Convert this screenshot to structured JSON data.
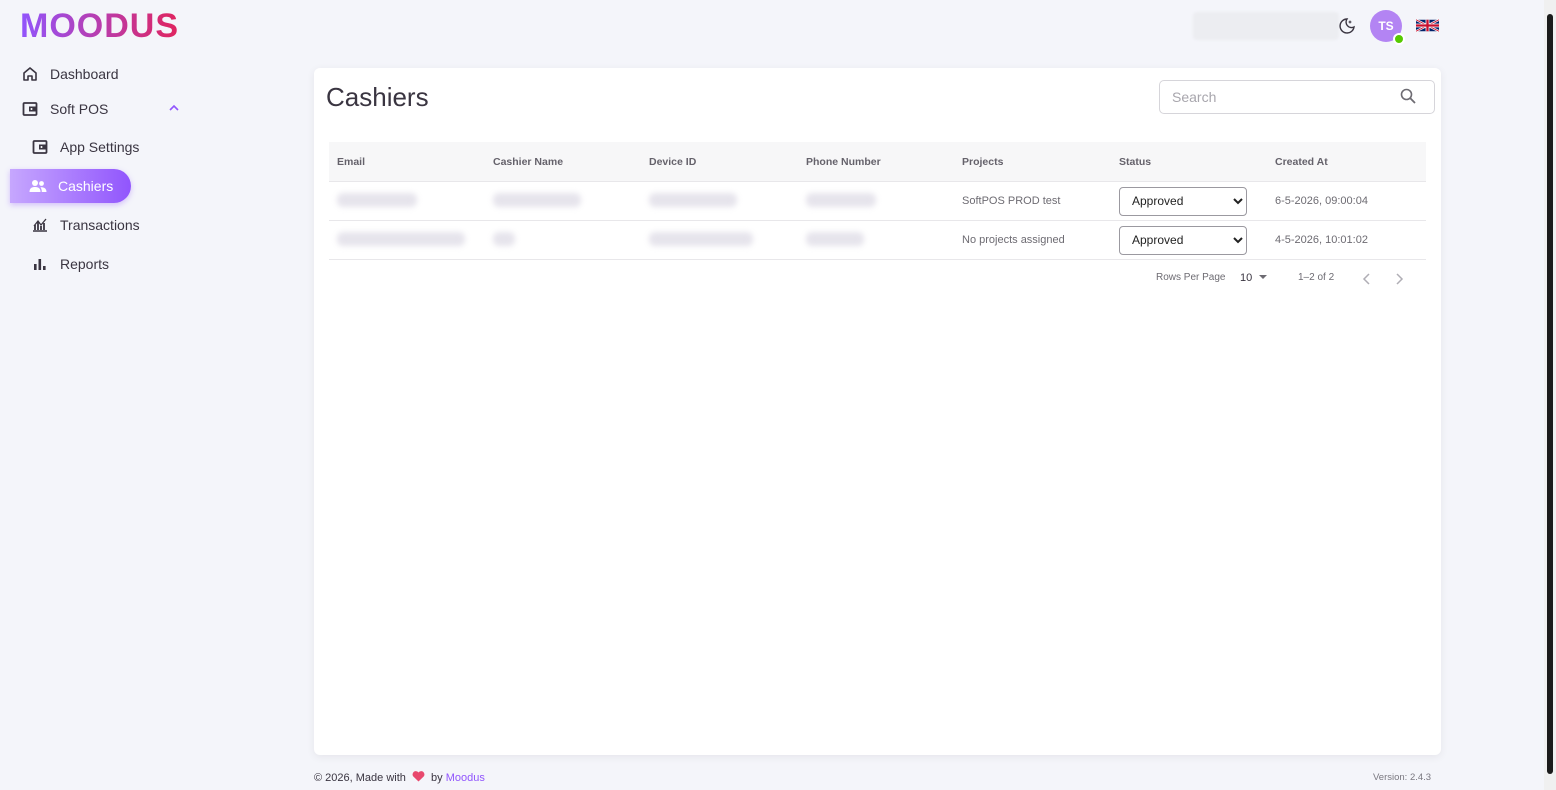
{
  "brand": {
    "name": "MOODUS",
    "accent": "#9155fd",
    "logo_start": "#9155fd",
    "logo_end": "#e0245e"
  },
  "sidebar": {
    "items": [
      {
        "label": "Dashboard",
        "icon": "home-icon"
      },
      {
        "label": "Soft POS",
        "icon": "wallet-icon",
        "expanded": true
      },
      {
        "label": "App Settings",
        "icon": "wallet-icon"
      },
      {
        "label": "Cashiers",
        "icon": "users-icon",
        "active": true
      },
      {
        "label": "Transactions",
        "icon": "transactions-icon"
      },
      {
        "label": "Reports",
        "icon": "bar-chart-icon"
      }
    ]
  },
  "topbar": {
    "avatar_initials": "TS",
    "theme_icon": "moon-icon",
    "language_icon": "uk-flag-icon"
  },
  "page": {
    "title": "Cashiers"
  },
  "search": {
    "placeholder": "Search"
  },
  "table": {
    "columns": [
      "Email",
      "Cashier Name",
      "Device ID",
      "Phone Number",
      "Projects",
      "Status",
      "Created At"
    ],
    "rows": [
      {
        "projects": "SoftPOS PROD test",
        "status": "Approved",
        "created_at": "6-5-2026, 09:00:04"
      },
      {
        "projects": "No projects assigned",
        "status": "Approved",
        "created_at": "4-5-2026, 10:01:02"
      }
    ],
    "status_options": [
      "Approved"
    ]
  },
  "pagination": {
    "rows_per_page_label": "Rows Per Page",
    "rows_per_page": "10",
    "range": "1–2 of 2"
  },
  "footer": {
    "copyright_prefix": "© 2026, Made with",
    "by": "by",
    "brand_link": "Moodus",
    "version": "Version: 2.4.3"
  }
}
